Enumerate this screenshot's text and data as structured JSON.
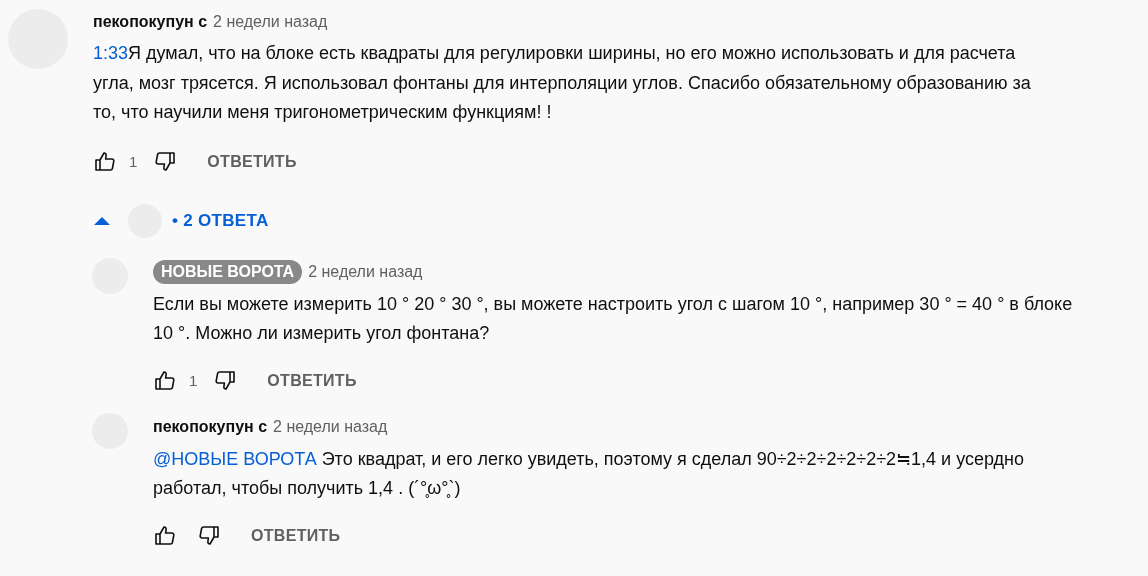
{
  "comment": {
    "author": "пекопокупун с",
    "author_highlighted": false,
    "time": "2 недели назад",
    "link": "1:33",
    "text": "Я думал, что на блоке есть квадраты для регулировки ширины, но его можно использовать и для расчета угла, мозг трясется. Я использовал фонтаны для интерполяции углов. Спасибо обязательному образованию за то, что научили меня тригонометрическим функциям! !",
    "likes": "1",
    "reply_label": "ОТВЕТИТЬ"
  },
  "replies_toggle": {
    "expanded": true,
    "label": "• 2 ОТВЕТА"
  },
  "replies": [
    {
      "author": "НОВЫЕ ВОРОТА",
      "author_highlighted": true,
      "time": "2 недели назад",
      "text": "Если вы можете измерить 10 ° 20 ° 30 °, вы можете настроить угол с шагом 10 °, например 30 ° = 40 ° в блоке 10 °. Можно ли измерить угол фонтана?",
      "likes": "1",
      "reply_label": "ОТВЕТИТЬ"
    },
    {
      "author": "пекопокупун с",
      "author_highlighted": false,
      "time": "2 недели назад",
      "link": "@НОВЫЕ ВОРОТА",
      "text": " Это квадрат, и его легко увидеть, поэтому я сделал 90÷2÷2÷2÷2÷2÷2≒1,4 и усердно работал, чтобы получить 1,4 . (´°̥ω°̥`)",
      "reply_label": "ОТВЕТИТЬ"
    }
  ]
}
